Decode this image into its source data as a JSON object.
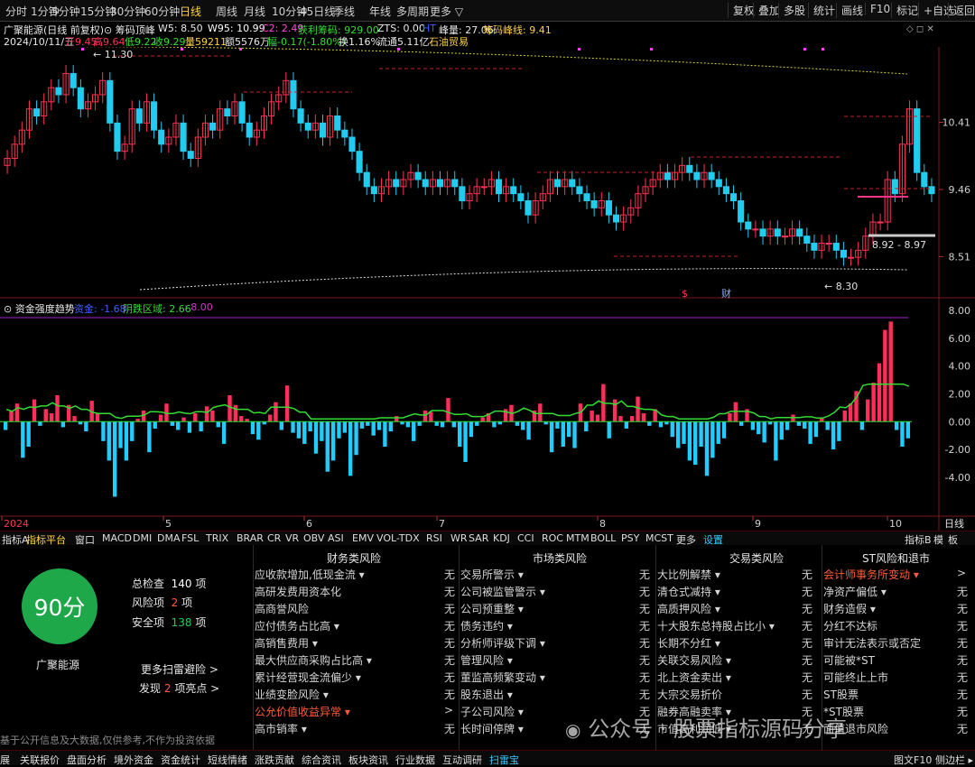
{
  "periods": [
    "分时",
    "1分钟",
    "5分钟",
    "15分钟",
    "30分钟",
    "60分钟",
    "日线",
    "周线",
    "月线",
    "10分钟",
    "45日线",
    "季线",
    "年线",
    "多周期",
    "更多 ▽"
  ],
  "active_period": "日线",
  "right_tools": [
    "复权",
    "叠加",
    "多股",
    "统计",
    "画线",
    "F10",
    "标记",
    "+自选",
    "返回"
  ],
  "title": {
    "stock": "广聚能源(日线 前复权)",
    "indicator": "筹码顶峰",
    "w5": "W5: 8.50",
    "w95": "W95: 10.99",
    "c2": "C2: 2.49",
    "profit": "获利筹码: 929.00",
    "zts": "ZTS: 0.00",
    "ht": "HT",
    "peak": "峰量: 27.06",
    "peakline": "筹码峰线: 9.41"
  },
  "quote": {
    "date": "2024/10/11/五",
    "open": "开9.45",
    "high": "高9.64",
    "low": "低9.22",
    "close": "收9.29",
    "volume": "量59211",
    "amount": "额5576万",
    "change": "幅-0.17(-1.80%)",
    "turnover": "换1.16%",
    "float": "流通5.11亿",
    "sector": "石油贸易"
  },
  "price_axis": [
    "10.41",
    "9.46",
    "8.51"
  ],
  "price_notes": {
    "high": "11.30",
    "low": "8.30",
    "range": "8.92 - 8.97"
  },
  "event_marks": [
    "$",
    "财"
  ],
  "sub_chart": {
    "name": "资金强度趋势",
    "s1_label": "资金: -1.68",
    "s2_label": "阴跌区域: 2.66",
    "s3_label": ": 8.00",
    "axis": [
      "8.00",
      "6.00",
      "4.00",
      "2.00",
      "0.00",
      "-2.00",
      "-4.00"
    ]
  },
  "chart_data": {
    "type": "bar",
    "x": [
      "2024",
      "5",
      "6",
      "7",
      "8",
      "9",
      "10"
    ],
    "values": [
      -0.6,
      0.8,
      1.3,
      -2.6,
      -1.8,
      1.6,
      -0.3,
      0.9,
      0.6,
      1.9,
      -0.4,
      1.2,
      0.4,
      -0.2,
      -0.7,
      1.5,
      0.6,
      -1.4,
      -2.8,
      -5.4,
      -1.9,
      -2.8,
      -1.4,
      0.2,
      0.8,
      -2.2,
      -0.5,
      0.5,
      1.3,
      -0.3,
      -0.6,
      0.3,
      -0.8,
      0.6,
      -0.7,
      1.1,
      0.8,
      -0.4,
      -1.6,
      1.9,
      1.2,
      0.4,
      0.2,
      -0.9,
      -1.3,
      -0.2,
      0.5,
      1.4,
      -0.6,
      2.6,
      -0.8,
      -1.2,
      -1.6,
      -0.7,
      -2.3,
      -1.4,
      -3.6,
      -2.8,
      -1.2,
      -0.8,
      -3.9,
      -2.4,
      -0.5,
      -0.3,
      -1.0,
      -0.6,
      -1.8,
      -0.7,
      0.4,
      -0.2,
      -0.4,
      -1.4,
      -0.3,
      0.8,
      0.7,
      -0.3,
      -0.4,
      1.7,
      -0.4,
      -1.8,
      -2.9,
      -1.1,
      -0.3,
      0.3,
      0.6,
      -0.4,
      -0.2,
      0.9,
      1.2,
      -0.3,
      -0.6,
      -1.3,
      0.8,
      1.3,
      -0.2,
      -2.2,
      -0.5,
      -1.8,
      -1.1,
      -1.9,
      1.3,
      -0.7,
      0.8,
      0.5,
      2.7,
      -1.2,
      1.6,
      0.4,
      -0.5,
      0.4,
      1.8,
      0.6,
      -0.3,
      0.9,
      -0.4,
      -0.2,
      -1.1,
      -1.9,
      -1.6,
      -2.8,
      -3.1,
      -1.8,
      -3.9,
      -2.6,
      -1.6,
      -1.2,
      0.6,
      1.4,
      -0.3,
      0.9,
      -0.6,
      -0.9,
      -1.5,
      -0.2,
      -2.8,
      -1.3,
      -0.6,
      0.5,
      -0.3,
      -0.5,
      -1.6,
      -1.1,
      0.3,
      -0.6,
      -2.0,
      -1.4,
      0.8,
      1.3,
      2.2,
      -0.6,
      1.6,
      2.8,
      4.2,
      6.6,
      7.2,
      -0.6,
      -1.8,
      -1.2
    ],
    "ylim": [
      -5.5,
      8.0
    ],
    "series": [
      {
        "name": "资金"
      },
      {
        "name": "阴跌区域"
      }
    ]
  },
  "tabs": [
    "指标A",
    "指标平台",
    "窗口",
    "MACD",
    "DMI",
    "DMA",
    "FSL",
    "TRIX",
    "BRAR",
    "CR",
    "VR",
    "OBV",
    "ASI",
    "EMV",
    "VOL-TDX",
    "RSI",
    "WR",
    "SAR",
    "KDJ",
    "CCI",
    "ROC",
    "MTM",
    "BOLL",
    "PSY",
    "MCST",
    "更多",
    "设置"
  ],
  "tabs_right": [
    "指标B",
    "模",
    "板"
  ],
  "period_label": "日线",
  "scan": {
    "score": "90分",
    "company": "广聚能源",
    "total_label": "总检查",
    "total": "140",
    "unit": "项",
    "risk_label": "风险项",
    "risk": "2",
    "safe_label": "安全项",
    "safe": "138",
    "more": "更多扫雷避险 >",
    "found_pre": "发现",
    "found": "2",
    "found_post": "项亮点 >",
    "disclaimer": "基于公开信息及大数据,仅供参考,不作为投资依据"
  },
  "columns": [
    {
      "title": "财务类风险",
      "items": [
        {
          "label": "应收款增加,低现金流 ▾",
          "value": "无"
        },
        {
          "label": "高研发费用资本化",
          "value": "无"
        },
        {
          "label": "高商誉风险",
          "value": "无"
        },
        {
          "label": "应付债务占比高 ▾",
          "value": "无"
        },
        {
          "label": "高销售费用 ▾",
          "value": "无"
        },
        {
          "label": "最大供应商采购占比高 ▾",
          "value": "无"
        },
        {
          "label": "累计经营现金流偏少 ▾",
          "value": "无"
        },
        {
          "label": "业绩变脸风险 ▾",
          "value": "无"
        },
        {
          "label": "公允价值收益异常 ▾",
          "value": ">",
          "hl": true
        },
        {
          "label": "高市销率 ▾",
          "value": "无"
        }
      ]
    },
    {
      "title": "市场类风险",
      "items": [
        {
          "label": "交易所警示 ▾",
          "value": "无"
        },
        {
          "label": "公司被监管警示 ▾",
          "value": "无"
        },
        {
          "label": "公司预重整 ▾",
          "value": "无"
        },
        {
          "label": "债务违约 ▾",
          "value": "无"
        },
        {
          "label": "分析师评级下调 ▾",
          "value": "无"
        },
        {
          "label": "管理风险 ▾",
          "value": "无"
        },
        {
          "label": "董监高频繁变动 ▾",
          "value": "无"
        },
        {
          "label": "股东退出 ▾",
          "value": "无"
        },
        {
          "label": "子公司风险 ▾",
          "value": "无"
        },
        {
          "label": "长时间停牌 ▾",
          "value": "无"
        }
      ]
    },
    {
      "title": "交易类风险",
      "items": [
        {
          "label": "大比例解禁 ▾",
          "value": "无"
        },
        {
          "label": "清仓式减持 ▾",
          "value": "无"
        },
        {
          "label": "高质押风险 ▾",
          "value": "无"
        },
        {
          "label": "十大股东总持股占比小 ▾",
          "value": "无"
        },
        {
          "label": "长期不分红 ▾",
          "value": "无"
        },
        {
          "label": "关联交易风险 ▾",
          "value": "无"
        },
        {
          "label": "北上资金卖出 ▾",
          "value": "无"
        },
        {
          "label": "大宗交易折价",
          "value": "无"
        },
        {
          "label": "融券高融卖率 ▾",
          "value": "无"
        },
        {
          "label": "市值高利润低 ▾",
          "value": "无"
        }
      ]
    },
    {
      "title": "ST风险和退市",
      "items": [
        {
          "label": "会计师事务所变动 ▾",
          "value": ">",
          "hl": true
        },
        {
          "label": "净资产偏低 ▾",
          "value": "无"
        },
        {
          "label": "财务造假 ▾",
          "value": "无"
        },
        {
          "label": "分红不达标",
          "value": "无"
        },
        {
          "label": "审计无法表示或否定",
          "value": "无"
        },
        {
          "label": "可能被*ST",
          "value": "无"
        },
        {
          "label": "可能终止上市",
          "value": "无"
        },
        {
          "label": "ST股票",
          "value": "无"
        },
        {
          "label": "*ST股票",
          "value": "无"
        },
        {
          "label": "面值退市风险",
          "value": "无"
        }
      ]
    }
  ],
  "bottom_tabs": [
    "展",
    "关联报价",
    "盘面分析",
    "境外资金",
    "资金统计",
    "短线情绪",
    "涨跌贡献",
    "综合资讯",
    "板块资讯",
    "行业数据",
    "互动调研",
    "扫雷宝"
  ],
  "bottom_right": [
    "图文F10",
    "侧边栏 ▸"
  ],
  "watermark": "公众号 · 股票指标源码分享",
  "colors": {
    "up": "#ff3355",
    "down": "#22ccee",
    "active": "#ffd24a",
    "score": "#1fa84a",
    "line": "#33dd33"
  }
}
